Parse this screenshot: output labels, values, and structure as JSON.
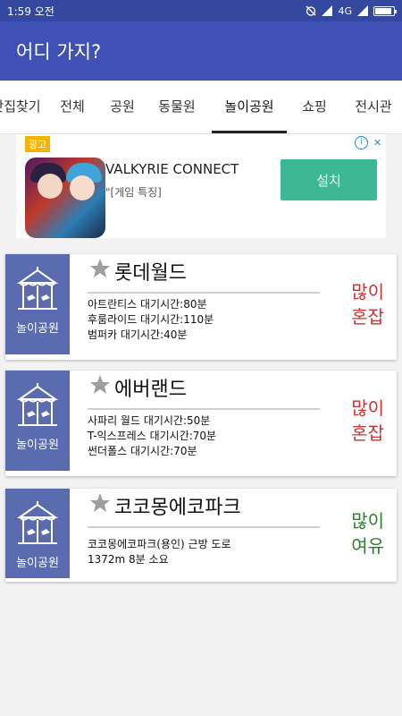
{
  "status_bar": {
    "time": "1:59 오전",
    "network": "4G"
  },
  "app_bar": {
    "title": "어디 가지?"
  },
  "tabs": [
    {
      "label": "맛집찾기"
    },
    {
      "label": "전체"
    },
    {
      "label": "공원"
    },
    {
      "label": "동물원"
    },
    {
      "label": "놀이공원"
    },
    {
      "label": "쇼핑"
    },
    {
      "label": "전시관"
    }
  ],
  "active_tab": "놀이공원",
  "ad": {
    "badge": "광고",
    "title": "VALKYRIE CONNECT",
    "subtitle": "\"[게임 특징]",
    "install_label": "설치",
    "info_icon": "info-icon",
    "close_icon": "close-icon"
  },
  "cards": [
    {
      "category": "놀이공원",
      "name": "롯데월드",
      "lines": [
        "아트란티스 대기시간:80분",
        "후룸라이드 대기시간:110분",
        "범퍼카 대기시간:40분"
      ],
      "crowd_line1": "많이",
      "crowd_line2": "혼잡",
      "crowd_color": "#d32f2f"
    },
    {
      "category": "놀이공원",
      "name": "에버랜드",
      "lines": [
        "사파리 월드 대기시간:50분",
        "T-익스프레스 대기시간:70분",
        "썬더폴스 대기시간:70분"
      ],
      "crowd_line1": "많이",
      "crowd_line2": "혼잡",
      "crowd_color": "#d32f2f"
    },
    {
      "category": "놀이공원",
      "name": "코코몽에코파크",
      "lines": [
        "코코몽에코파크(용인) 근방 도로",
        "1372m 8분 소요",
        ""
      ],
      "crowd_line1": "많이",
      "crowd_line2": "여유",
      "crowd_color": "#2e7d32"
    }
  ],
  "colors": {
    "status_bar": "#3548a0",
    "app_bar": "#3f51b5",
    "thumb": "#5b6bb0",
    "install_button": "#3db894"
  }
}
